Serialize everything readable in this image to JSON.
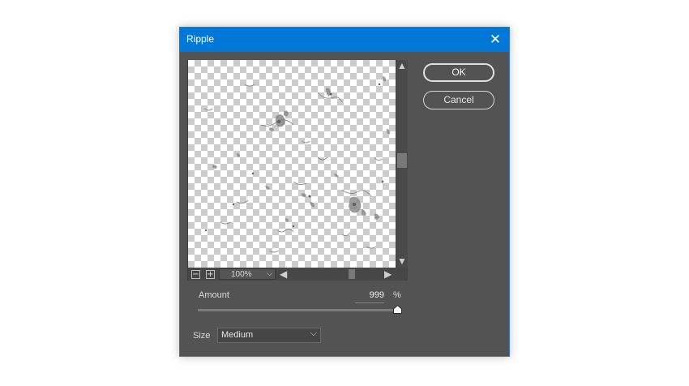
{
  "dialog": {
    "title": "Ripple",
    "close_icon": "close-icon"
  },
  "preview": {
    "zoom_out_glyph": "−",
    "zoom_in_glyph": "+",
    "zoom_level": "100%",
    "zoom_caret": "⌵",
    "arrows": {
      "up": "▲",
      "down": "▼",
      "left": "◀",
      "right": "▶"
    },
    "vertical_scroll_position": 0.48,
    "horizontal_scroll_position": 0.67
  },
  "buttons": {
    "ok_label": "OK",
    "cancel_label": "Cancel"
  },
  "amount": {
    "label": "Amount",
    "value": "999",
    "unit": "%",
    "slider_fraction": 1.0
  },
  "size": {
    "label": "Size",
    "selected": "Medium",
    "caret": "⌵"
  },
  "colors": {
    "titlebar": "#0078d7",
    "dialog_bg": "#535353",
    "accent_underline": "#4a8cdc"
  }
}
